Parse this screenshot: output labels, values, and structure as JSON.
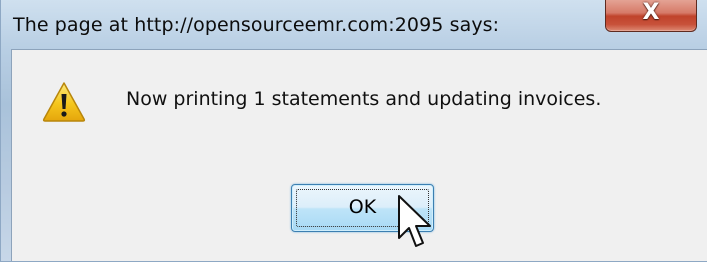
{
  "dialog": {
    "title": "The page at http://opensourceemr.com:2095 says:",
    "close_glyph": "X",
    "message": "Now printing 1 statements and updating invoices.",
    "icon": "warning-icon",
    "ok_label": "OK"
  },
  "colors": {
    "titlebar": "#b9cfe4",
    "client_background": "#f0f0f0",
    "close_button": "#c8513a",
    "ok_button_border": "#3c7fb1",
    "warning_fill": "#f3c21c"
  }
}
